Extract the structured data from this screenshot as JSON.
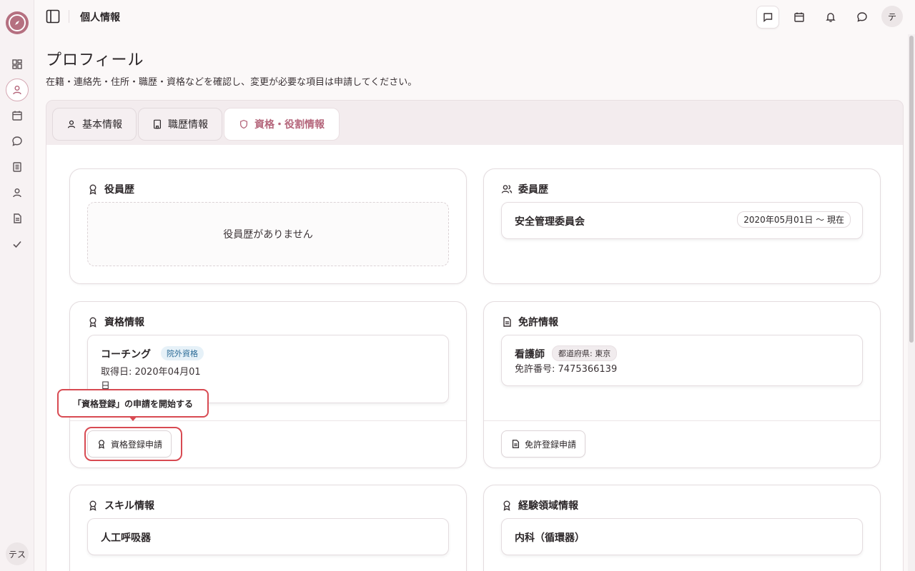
{
  "header": {
    "title": "個人情報",
    "avatar": "テ"
  },
  "sidebar": {
    "avatar": "テス"
  },
  "page": {
    "title": "プロフィール",
    "subtitle": "在籍・連絡先・住所・職歴・資格などを確認し、変更が必要な項目は申請してください。"
  },
  "tabs": [
    {
      "label": "基本情報"
    },
    {
      "label": "職歴情報"
    },
    {
      "label": "資格・役割情報"
    }
  ],
  "cards": {
    "officer": {
      "title": "役員歴",
      "empty": "役員歴がありません"
    },
    "committee": {
      "title": "委員歴",
      "item": "安全管理委員会",
      "period": "2020年05月01日 〜 現在"
    },
    "qualification": {
      "title": "資格情報",
      "item": "コーチング",
      "badge": "院外資格",
      "date_line1": "取得日: 2020年04月01",
      "date_line2": "日",
      "button": "資格登録申請"
    },
    "license": {
      "title": "免許情報",
      "item": "看護師",
      "badge": "都道府県: 東京",
      "number": "免許番号: 7475366139",
      "button": "免許登録申請"
    },
    "skill": {
      "title": "スキル情報",
      "item": "人工呼吸器"
    },
    "experience": {
      "title": "経験領域情報",
      "item": "内科（循環器）"
    }
  },
  "tooltip": {
    "text": "「資格登録」の申請を開始する"
  },
  "colors": {
    "accent": "#b5677c",
    "highlight": "#d84a52"
  }
}
